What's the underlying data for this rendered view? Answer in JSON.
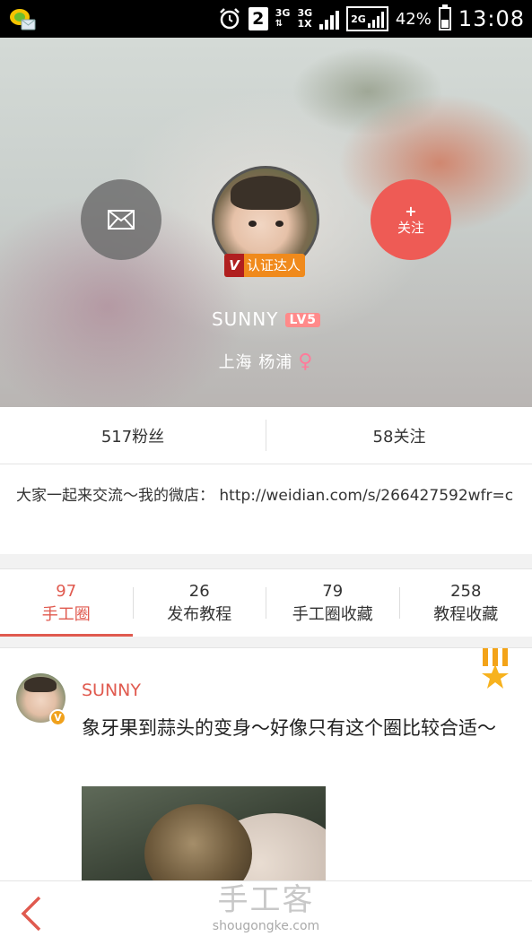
{
  "status_bar": {
    "sim_slot": "2",
    "network_top": "3G",
    "network_2_top": "3G",
    "network_2_bottom": "1X",
    "network_3": "2G",
    "battery": "42%",
    "time": "13:08"
  },
  "profile": {
    "name": "SUNNY",
    "level": "LV5",
    "location": "上海  杨浦",
    "gender_symbol": "♀",
    "verified_label": "认证达人",
    "verified_mark": "V",
    "follow_plus": "+",
    "follow_label": "关注"
  },
  "counts": {
    "fans": "517粉丝",
    "following": "58关注"
  },
  "bio": "大家一起来交流～我的微店：  http://weidian.com/s/266427592wfr=c",
  "tabs": [
    {
      "count": "97",
      "label": "手工圈"
    },
    {
      "count": "26",
      "label": "发布教程"
    },
    {
      "count": "79",
      "label": "手工圈收藏"
    },
    {
      "count": "258",
      "label": "教程收藏"
    }
  ],
  "post": {
    "author": "SUNNY",
    "badge": "V",
    "text": "象牙果到蒜头的变身～好像只有这个圈比较合适～"
  },
  "watermark": {
    "title": "手工客",
    "domain": "shougongke.com"
  },
  "colors": {
    "accent": "#e05a4f",
    "follow_button": "#ee5b55",
    "level_badge": "#ff8a8a",
    "verified_badge": "#f08a1c"
  }
}
